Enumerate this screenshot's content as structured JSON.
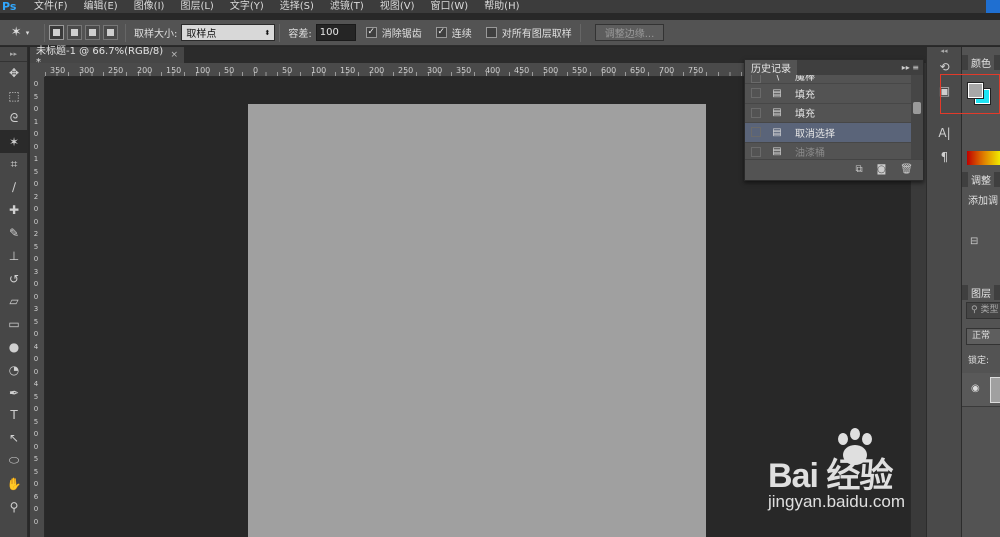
{
  "app": {
    "logo": "Ps"
  },
  "menu": [
    "文件(F)",
    "编辑(E)",
    "图像(I)",
    "图层(L)",
    "文字(Y)",
    "选择(S)",
    "滤镜(T)",
    "视图(V)",
    "窗口(W)",
    "帮助(H)"
  ],
  "options": {
    "sample_size_label": "取样大小:",
    "sample_size_value": "取样点",
    "tolerance_label": "容差:",
    "tolerance_value": "100",
    "antialias_label": "消除锯齿",
    "antialias_checked": true,
    "contiguous_label": "连续",
    "contiguous_checked": true,
    "all_layers_label": "对所有图层取样",
    "all_layers_checked": false,
    "refine_edge_label": "调整边缘..."
  },
  "document_tab": {
    "title": "未标题-1 @ 66.7%(RGB/8) *",
    "close": "×"
  },
  "ruler": {
    "horizontal": [
      "350",
      "300",
      "250",
      "200",
      "150",
      "100",
      "50",
      "0",
      "50",
      "100",
      "150",
      "200",
      "250",
      "300",
      "350",
      "400",
      "450",
      "500",
      "550",
      "600",
      "650",
      "700",
      "750"
    ],
    "vertical": [
      "0",
      "5",
      "0",
      "1",
      "0",
      "0",
      "1",
      "5",
      "0",
      "2",
      "0",
      "0",
      "2",
      "5",
      "0",
      "3",
      "0",
      "0",
      "3",
      "5",
      "0",
      "4",
      "0",
      "0",
      "4",
      "5",
      "0",
      "5",
      "0",
      "0",
      "5",
      "5",
      "0",
      "6",
      "0",
      "0"
    ]
  },
  "history": {
    "tab": "历史记录",
    "items": [
      {
        "label": "魔棒",
        "state": "partial"
      },
      {
        "label": "填充",
        "state": "normal"
      },
      {
        "label": "填充",
        "state": "normal"
      },
      {
        "label": "取消选择",
        "state": "selected"
      },
      {
        "label": "油漆桶",
        "state": "greyed"
      }
    ]
  },
  "panels": {
    "color_tab": "颜色",
    "adjust_tab": "调整",
    "adjust_hint": "添加调",
    "layers_tab": "图层",
    "search_placeholder": "类型",
    "blend_mode": "正常",
    "lock_label": "锁定:"
  },
  "colors": {
    "foreground": "#a8a8a8",
    "background": "#1ee4f4",
    "canvas": "#a0a0a0",
    "highlight": "#e23a2a"
  },
  "watermark": {
    "brand": "Bai  经验",
    "url": "jingyan.baidu.com"
  }
}
